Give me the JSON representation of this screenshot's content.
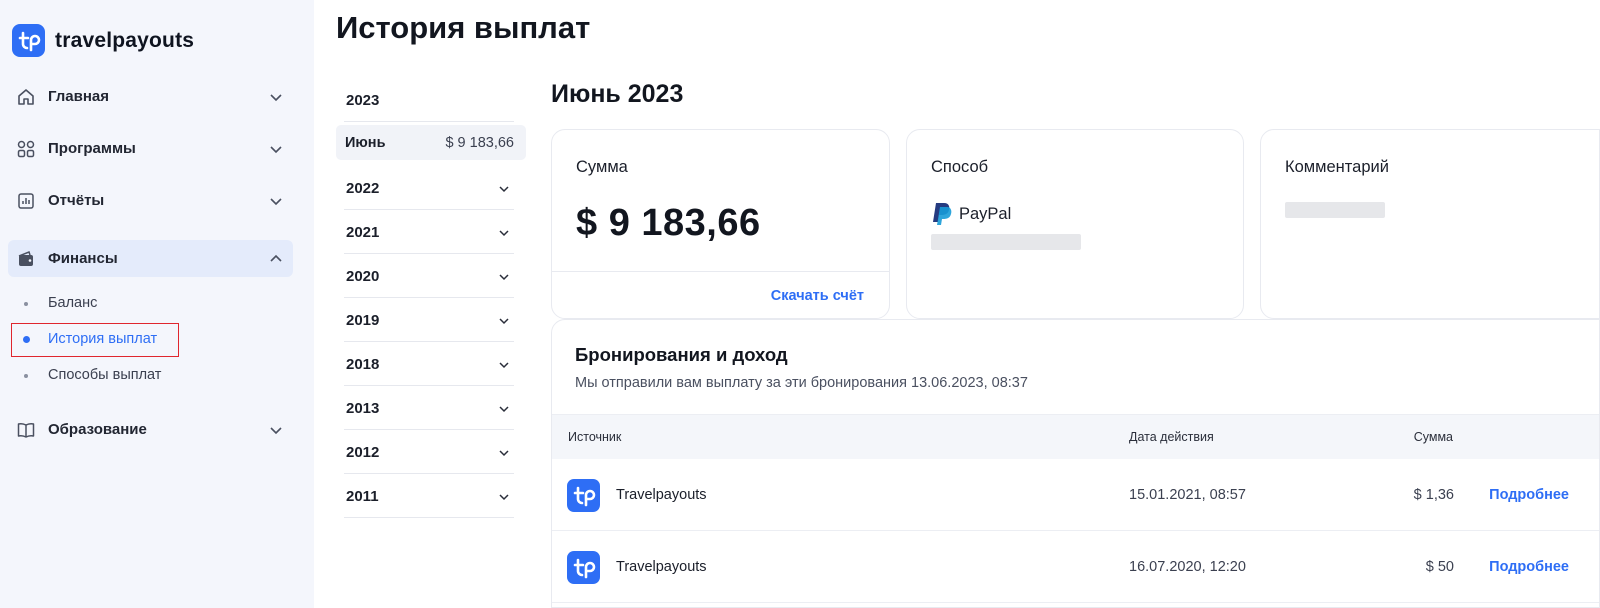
{
  "brand": {
    "name": "travelpayouts",
    "logo_icon": "tp-logo-icon"
  },
  "sidebar": {
    "items": [
      {
        "label": "Главная",
        "icon": "home-icon"
      },
      {
        "label": "Программы",
        "icon": "grid-icon"
      },
      {
        "label": "Отчёты",
        "icon": "chart-icon"
      },
      {
        "label": "Финансы",
        "icon": "wallet-icon"
      },
      {
        "label": "Образование",
        "icon": "book-icon"
      }
    ],
    "finance_sub": [
      {
        "label": "Баланс"
      },
      {
        "label": "История выплат"
      },
      {
        "label": "Способы выплат"
      }
    ]
  },
  "page": {
    "title": "История выплат"
  },
  "years": {
    "current_year": "2023",
    "selected_month": {
      "label": "Июнь",
      "amount": "$ 9 183,66"
    },
    "other_years": [
      "2022",
      "2021",
      "2020",
      "2019",
      "2018",
      "2013",
      "2012",
      "2011"
    ]
  },
  "detail": {
    "month_title": "Июнь 2023",
    "sum_card": {
      "label": "Сумма",
      "amount": "$ 9 183,66",
      "download_link": "Скачать счёт"
    },
    "method_card": {
      "label": "Способ",
      "method": "PayPal"
    },
    "comment_card": {
      "label": "Комментарий"
    }
  },
  "bookings": {
    "title": "Бронирования и доход",
    "subtitle": "Мы отправили вам выплату за эти бронирования 13.06.2023, 08:37",
    "columns": {
      "source": "Источник",
      "date": "Дата действия",
      "amount": "Сумма"
    },
    "rows": [
      {
        "source": "Travelpayouts",
        "date": "15.01.2021, 08:57",
        "amount": "$ 1,36",
        "link": "Подробнее"
      },
      {
        "source": "Travelpayouts",
        "date": "16.07.2020, 12:20",
        "amount": "$ 50",
        "link": "Подробнее"
      }
    ]
  },
  "colors": {
    "accent": "#2e6ef5",
    "sidebar_bg": "#f4f6fc",
    "highlight": "#e0262e"
  }
}
